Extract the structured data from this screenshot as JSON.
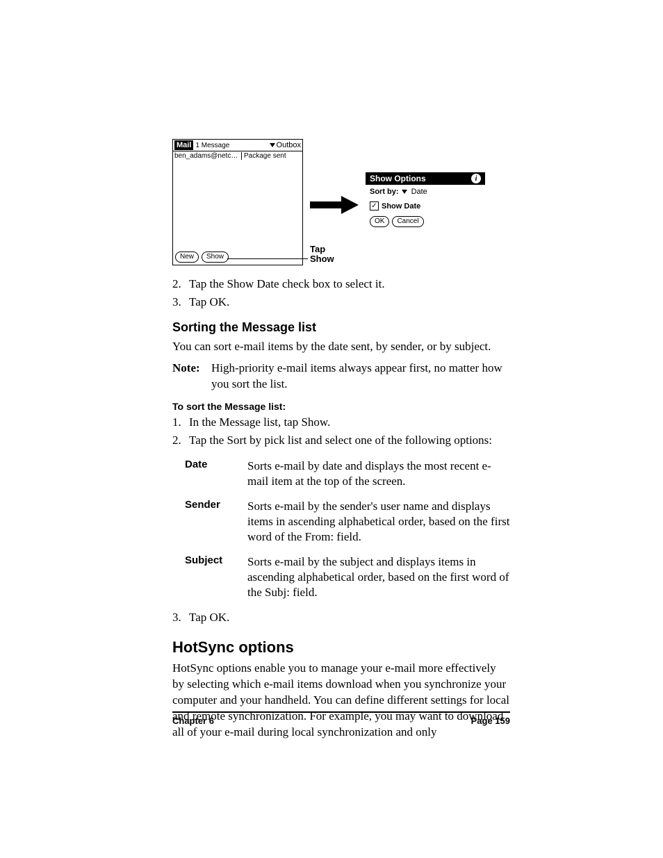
{
  "figure": {
    "mail": {
      "title": "Mail",
      "count": "1 Message",
      "folder": "Outbox",
      "row_sender": "ben_adams@netc…",
      "row_subject": "Package sent",
      "btn_new": "New",
      "btn_show": "Show"
    },
    "callout": {
      "line1": "Tap",
      "line2": "Show"
    },
    "options": {
      "title": "Show Options",
      "sortby_label": "Sort by:",
      "sortby_value": "Date",
      "showdate_label": "Show Date",
      "btn_ok": "OK",
      "btn_cancel": "Cancel"
    }
  },
  "steps_a": {
    "s2": "Tap the Show Date check box to select it.",
    "s3": "Tap OK."
  },
  "h3_sorting": "Sorting the Message list",
  "sorting_intro": "You can sort e-mail items by the date sent, by sender, or by subject.",
  "note": {
    "label": "Note:",
    "text": "High-priority e-mail items always appear first, no matter how you sort the list."
  },
  "h4_sort": "To sort the Message list:",
  "steps_b": {
    "s1": "In the Message list, tap Show.",
    "s2": "Tap the Sort by pick list and select one of the following options:"
  },
  "defs": {
    "date": {
      "term": "Date",
      "desc": "Sorts e-mail by date and displays the most recent e-mail item at the top of the screen."
    },
    "sender": {
      "term": "Sender",
      "desc": "Sorts e-mail by the sender's user name and displays items in ascending alphabetical order, based on the first word of the From: field."
    },
    "subject": {
      "term": "Subject",
      "desc": "Sorts e-mail by the subject and displays items in ascending alphabetical order, based on the first word of the Subj: field."
    }
  },
  "steps_c": {
    "s3": "Tap OK."
  },
  "h2_hotsync": "HotSync options",
  "hotsync_para": "HotSync options enable you to manage your e-mail more effectively by selecting which e-mail items download when you synchronize your computer and your handheld. You can define different settings for local and remote synchronization. For example, you may want to download all of your e-mail during local synchronization and only",
  "footer": {
    "left": "Chapter 6",
    "right": "Page 159"
  }
}
